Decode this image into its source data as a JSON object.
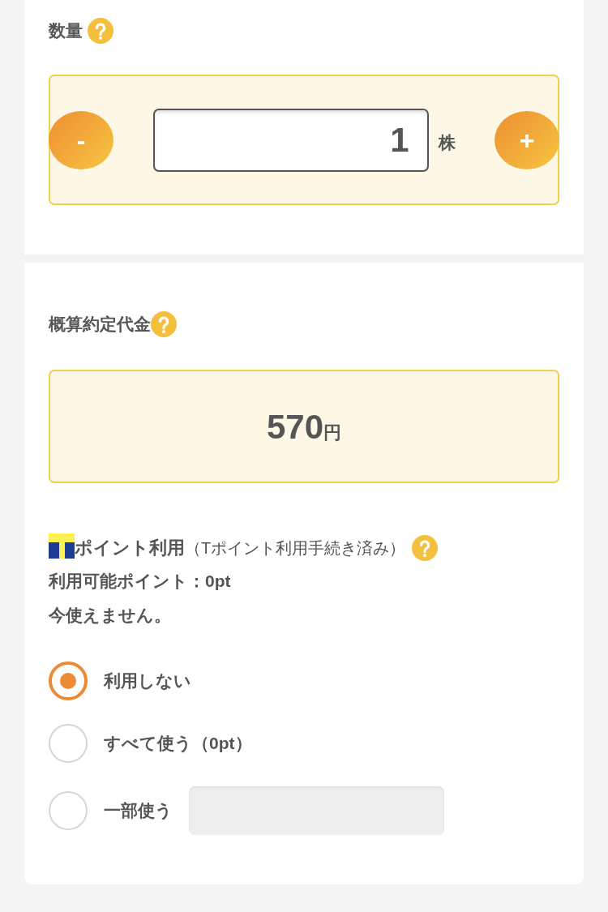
{
  "quantity": {
    "label": "数量",
    "stepper": {
      "decrement": "-",
      "value": "1",
      "unit": "株",
      "increment": "+"
    }
  },
  "estimate": {
    "label": "概算約定代金",
    "amount": "570",
    "currency": "円"
  },
  "tpoint": {
    "title": "ポイント利用",
    "note": "（Tポイント利用手続き済み）",
    "available": "利用可能ポイント：0pt",
    "message": "今使えません。",
    "options": [
      {
        "kind": "plain",
        "label": "利用しない",
        "selected": true
      },
      {
        "kind": "plain",
        "label": "すべて使う（0pt）",
        "selected": false
      },
      {
        "kind": "field",
        "label": "一部使う",
        "selected": false,
        "field": {
          "disabled": true
        }
      }
    ]
  }
}
